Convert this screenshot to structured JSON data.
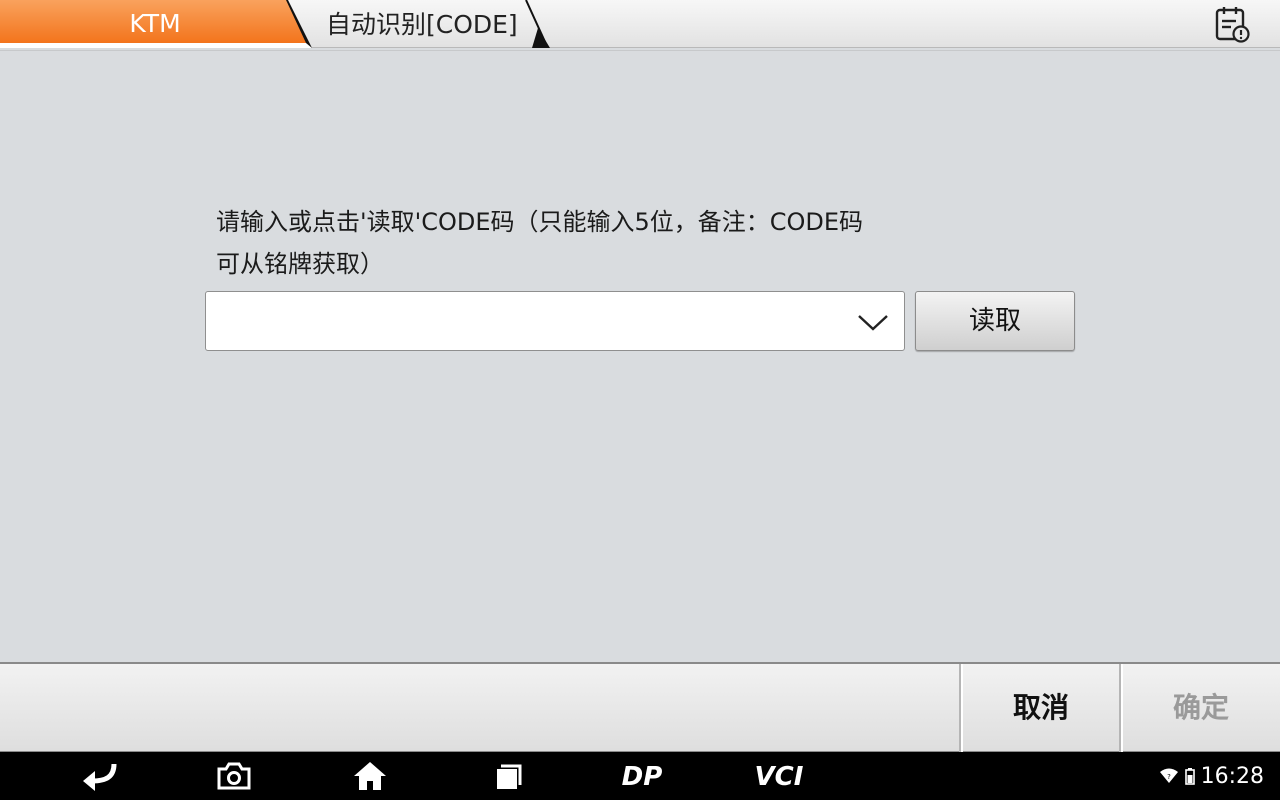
{
  "header": {
    "active_tab": "KTM",
    "current_tab": "自动识别[CODE]",
    "report_icon": "report-icon"
  },
  "main": {
    "prompt_line1": "请输入或点击'读取'CODE码（只能输入5位，备注：CODE码",
    "prompt_line2": "可从铭牌获取）",
    "code_value": "",
    "read_label": "读取"
  },
  "footer": {
    "cancel_label": "取消",
    "ok_label": "确定"
  },
  "navbar": {
    "icons": [
      "back-icon",
      "screenshot-icon",
      "home-icon",
      "recent-apps-icon",
      "dp-icon",
      "vci-icon"
    ],
    "dp_text": "DP",
    "vci_text": "VCI",
    "time": "16:28"
  },
  "colors": {
    "accent": "#f5812c",
    "accent_light": "#f9a25d",
    "background": "#d9dcdf",
    "nav_bg": "#000000",
    "disabled_text": "#9a9a9a"
  }
}
